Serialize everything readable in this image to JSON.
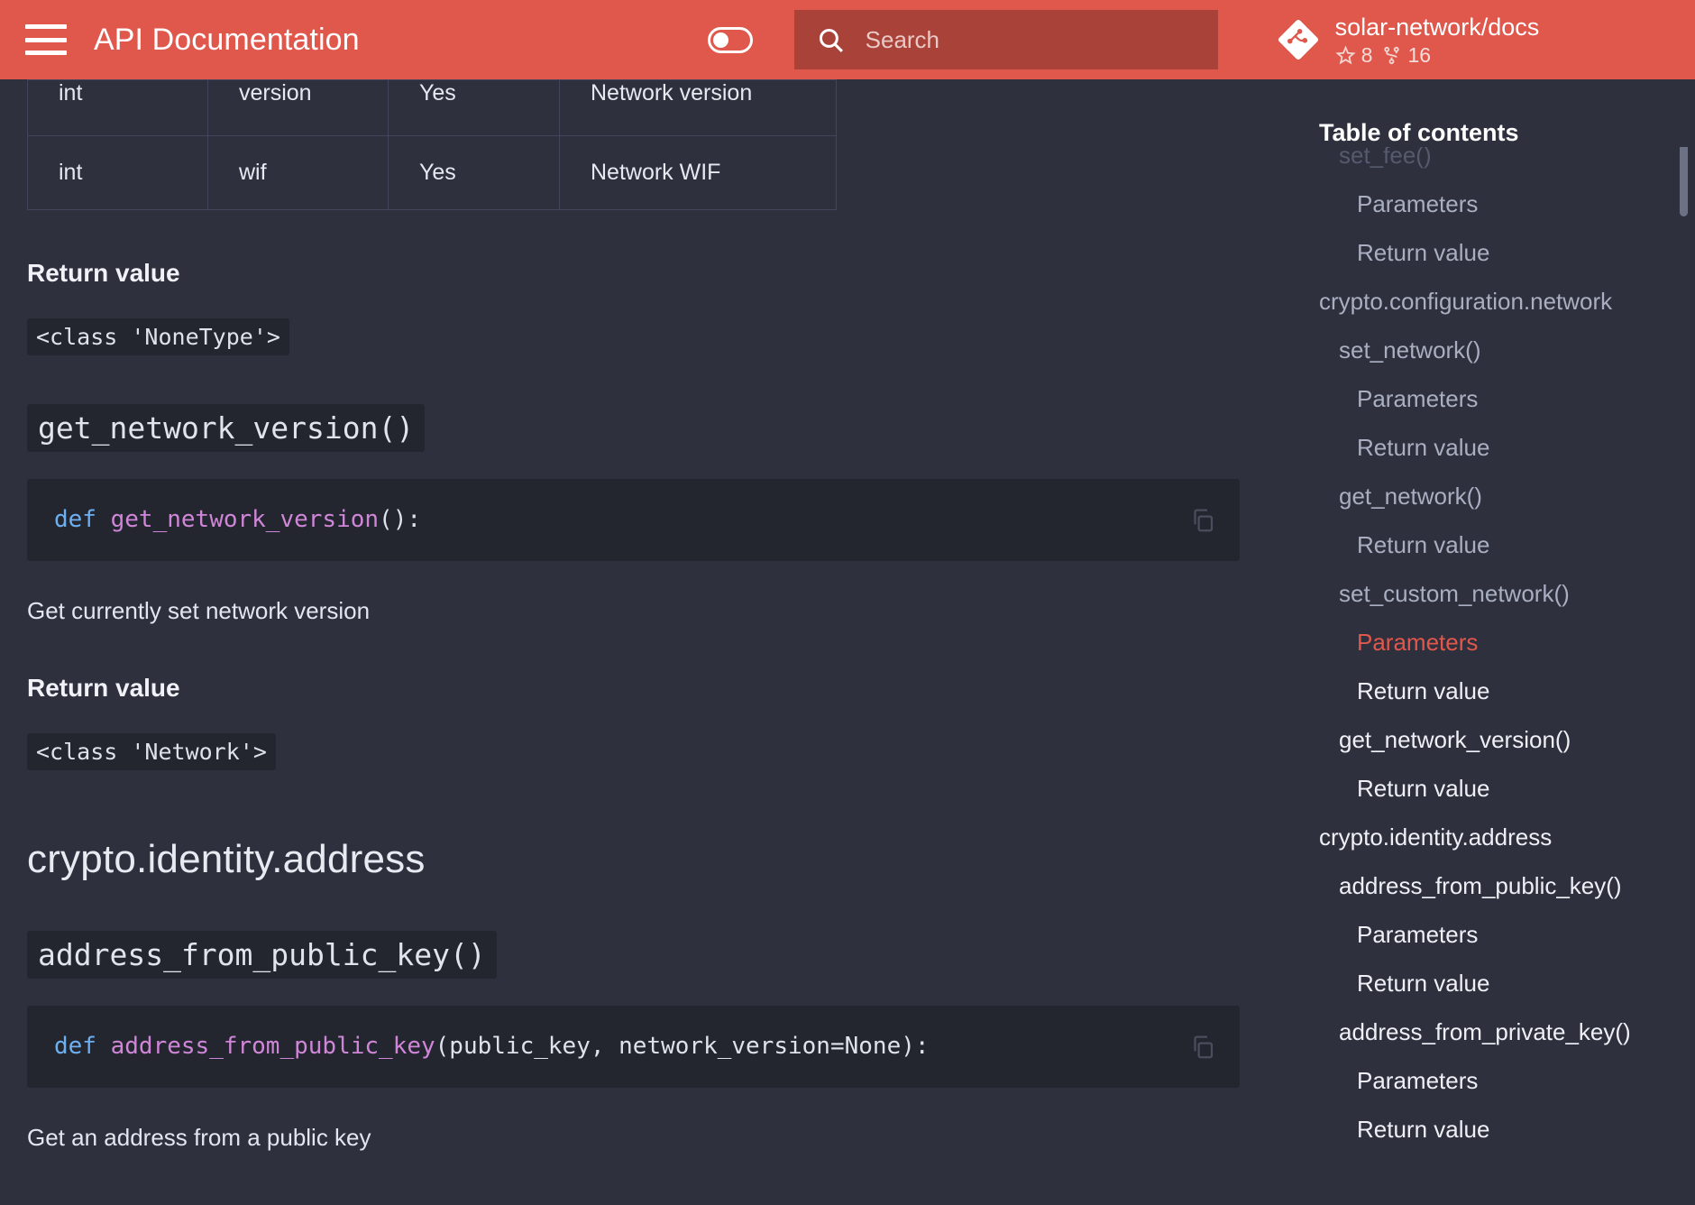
{
  "header": {
    "menu_icon": "hamburger-icon",
    "title": "API Documentation",
    "theme_toggle_icon": "theme-toggle",
    "search": {
      "icon": "search-icon",
      "placeholder": "Search",
      "value": ""
    },
    "repo": {
      "icon": "git-repo-icon",
      "name": "solar-network/docs",
      "star_icon": "star-icon",
      "stars": "8",
      "fork_icon": "fork-icon",
      "forks": "16"
    },
    "accent_color": "#e0574c",
    "search_bg": "#a94239"
  },
  "content": {
    "table": {
      "rows": [
        {
          "type": "int",
          "name": "version",
          "required": "Yes",
          "description": "Network version"
        },
        {
          "type": "int",
          "name": "wif",
          "required": "Yes",
          "description": "Network WIF"
        }
      ]
    },
    "blocks": {
      "return_value_1_heading": "Return value",
      "return_value_1_code": "<class 'NoneType'>",
      "fn1_heading": "get_network_version()",
      "fn1_code_kw": "def",
      "fn1_code_name": " get_network_version",
      "fn1_code_rest": "():",
      "fn1_desc": "Get currently set network version",
      "return_value_2_heading": "Return value",
      "return_value_2_code": "<class 'Network'>",
      "module_heading": "crypto.identity.address",
      "fn2_heading": "address_from_public_key()",
      "fn2_code_kw": "def",
      "fn2_code_name": " address_from_public_key",
      "fn2_code_rest": "(public_key, network_version=None):",
      "fn2_desc": "Get an address from a public key",
      "copy_icon": "copy-icon"
    }
  },
  "toc": {
    "title": "Table of contents",
    "items": [
      {
        "label": "set_fee()",
        "level": 2,
        "state": "faded"
      },
      {
        "label": "Parameters",
        "level": 3,
        "state": "normal"
      },
      {
        "label": "Return value",
        "level": 3,
        "state": "normal"
      },
      {
        "label": "crypto.configuration.network",
        "level": 1,
        "state": "normal"
      },
      {
        "label": "set_network()",
        "level": 2,
        "state": "normal"
      },
      {
        "label": "Parameters",
        "level": 3,
        "state": "normal"
      },
      {
        "label": "Return value",
        "level": 3,
        "state": "normal"
      },
      {
        "label": "get_network()",
        "level": 2,
        "state": "normal"
      },
      {
        "label": "Return value",
        "level": 3,
        "state": "normal"
      },
      {
        "label": "set_custom_network()",
        "level": 2,
        "state": "normal"
      },
      {
        "label": "Parameters",
        "level": 3,
        "state": "active"
      },
      {
        "label": "Return value",
        "level": 3,
        "state": "bright"
      },
      {
        "label": "get_network_version()",
        "level": 2,
        "state": "bright"
      },
      {
        "label": "Return value",
        "level": 3,
        "state": "bright"
      },
      {
        "label": "crypto.identity.address",
        "level": 1,
        "state": "bright"
      },
      {
        "label": "address_from_public_key()",
        "level": 2,
        "state": "bright"
      },
      {
        "label": "Parameters",
        "level": 3,
        "state": "bright"
      },
      {
        "label": "Return value",
        "level": 3,
        "state": "bright"
      },
      {
        "label": "address_from_private_key()",
        "level": 2,
        "state": "bright"
      },
      {
        "label": "Parameters",
        "level": 3,
        "state": "bright"
      },
      {
        "label": "Return value",
        "level": 3,
        "state": "bright"
      }
    ]
  }
}
